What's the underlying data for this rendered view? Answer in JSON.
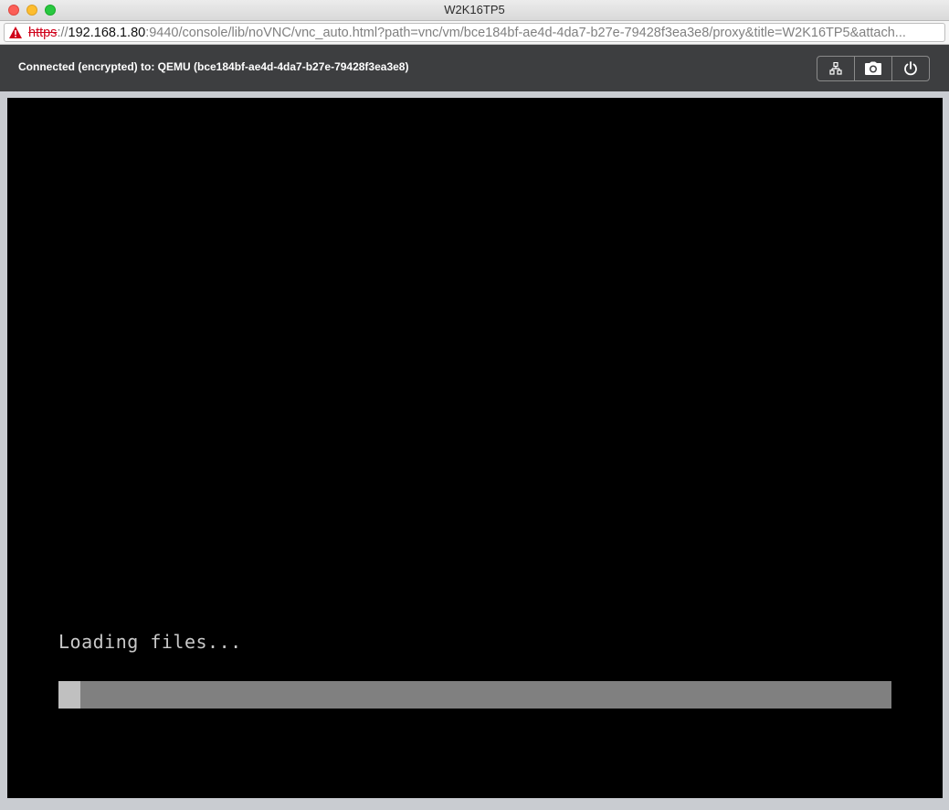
{
  "window": {
    "title": "W2K16TP5"
  },
  "address_bar": {
    "scheme": "https",
    "separator": "://",
    "host": "192.168.1.80",
    "rest": ":9440/console/lib/noVNC/vnc_auto.html?path=vnc/vm/bce184bf-ae4d-4da7-b27e-79428f3ea3e8/proxy&title=W2K16TP5&attach...",
    "security_icon": "warning-triangle-icon"
  },
  "status_bar": {
    "text": "Connected (encrypted) to: QEMU (bce184bf-ae4d-4da7-b27e-79428f3ea3e8)",
    "buttons": [
      {
        "icon": "network-icon"
      },
      {
        "icon": "camera-icon"
      },
      {
        "icon": "power-icon"
      }
    ]
  },
  "console": {
    "message": "Loading files...",
    "progress_fraction": 0.026
  },
  "colors": {
    "status_bar_bg": "#3d3e40",
    "screen_bg": "#000000",
    "progress_track": "#808080",
    "progress_fill": "#c0c0c0",
    "insecure_scheme": "#d0021b"
  }
}
